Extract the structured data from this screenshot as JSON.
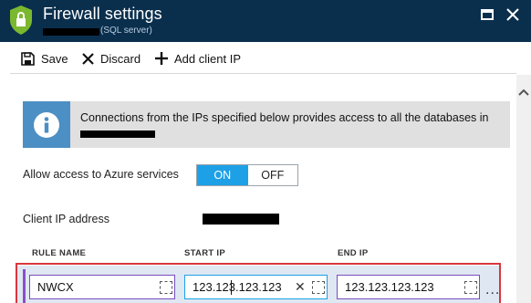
{
  "window": {
    "title": "Firewall settings",
    "subtitle": "(SQL server)",
    "colors": {
      "titlebar": "#0a2f4d",
      "accent": "#1ea0e6",
      "shield": "#7cb82f"
    }
  },
  "toolbar": {
    "save_label": "Save",
    "discard_label": "Discard",
    "add_client_ip_label": "Add client IP"
  },
  "info_banner": {
    "icon": "info-icon",
    "text": "Connections from the IPs specified below provides access to all the databases in"
  },
  "azure_access": {
    "label": "Allow access to Azure services",
    "on_label": "ON",
    "off_label": "OFF",
    "selected": "ON"
  },
  "client_ip": {
    "label": "Client IP address"
  },
  "rules_table": {
    "headers": [
      "RULE NAME",
      "START IP",
      "END IP"
    ],
    "rows": [
      {
        "rule_name": "NWCX",
        "start_ip": "123.123.123.123",
        "end_ip": "123.123.123.123"
      }
    ],
    "more_label": "..."
  }
}
